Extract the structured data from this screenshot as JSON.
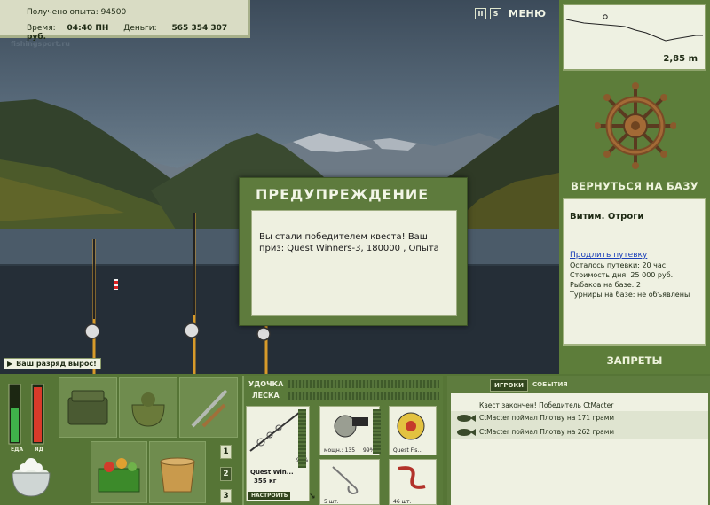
{
  "hud": {
    "exp_label": "Получено опыта:",
    "exp_value": "94500",
    "time_label": "Время:",
    "time_value": "04:40 ПН",
    "money_label": "Деньги:",
    "money_value": "565 354 307 руб.",
    "watermark": "fishingsport.ru"
  },
  "top_buttons": {
    "pause": "II",
    "sound": "S",
    "menu": "МЕНЮ"
  },
  "depth": {
    "value": "2,85 m"
  },
  "right": {
    "back_to_base": "ВЕРНУТЬСЯ НА БАЗУ",
    "location_name": "Витим. Отроги",
    "extend_link": "Продлить путевку",
    "trip_left": "Осталось путевки: 20 час.",
    "day_cost": "Стоимость дня: 25 000 руб.",
    "fishers": "Рыбаков на базе: 2",
    "tournaments": "Турниры на базе: не объявлены",
    "bans": "ЗАПРЕТЫ"
  },
  "modal": {
    "title": "ПРЕДУПРЕЖДЕНИЕ",
    "message": "Вы стали победителем квеста! Ваш приз: Quest Winners-3, 180000 , Опыта"
  },
  "notification": {
    "text": "Ваш разряд вырос!"
  },
  "status": {
    "eat_label": "ЕДА",
    "poison_label": "ЯД",
    "food_level": 0.6,
    "poison_level": 0.97
  },
  "slots": {
    "numbers": [
      "1",
      "2",
      "3"
    ]
  },
  "rod": {
    "rod_label": "УДОЧКА",
    "line_label": "ЛЕСКА",
    "rod_name": "Quest Win...",
    "rod_weight": "355 кг",
    "rod_percent": "99%",
    "reel_power": "мощн.: 135",
    "reel_percent": "99%",
    "line_name": "Quest Fis...",
    "hooks_count": "5 шт.",
    "bait_count": "46 шт.",
    "setup_button": "НАСТРОИТЬ"
  },
  "chat": {
    "tab_players": "ИГРОКИ",
    "tab_events": "СОБЫТИЯ",
    "messages": [
      "Квест закончен! Победитель CtMacter",
      "CtMacter поймал Плотву на 171 грамм",
      "CtMacter поймал Плотву на 262 грамм"
    ]
  },
  "colors": {
    "panel_green": "#5d7d3a",
    "light_panel": "#eff1e2",
    "link_blue": "#1a3fb8"
  }
}
